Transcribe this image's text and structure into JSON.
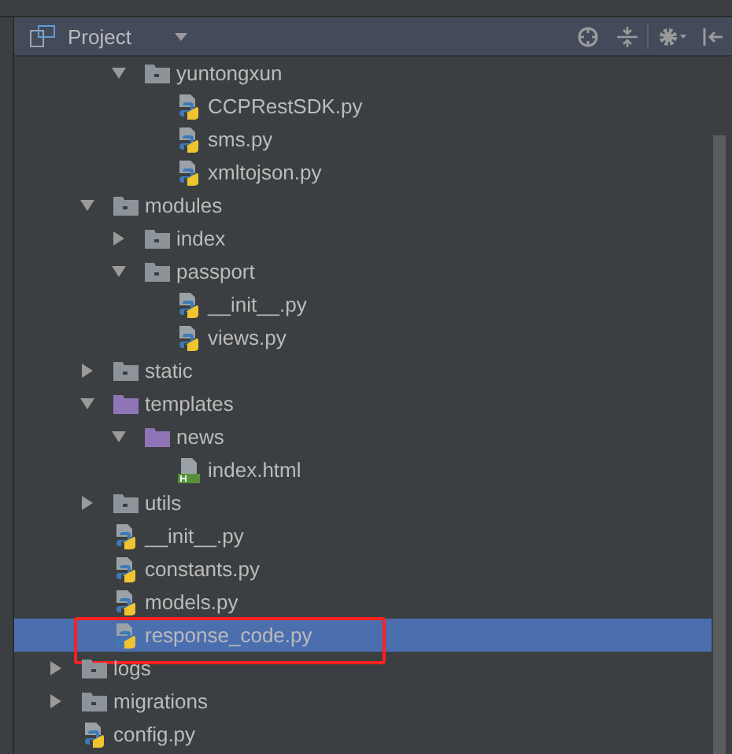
{
  "panel": {
    "title": "Project"
  },
  "tree": [
    {
      "children": [
        {
          "children": [
            {
              "label": "yuntongxun",
              "kind": "folder",
              "expanded": true,
              "selected": false,
              "children": [
                {
                  "label": "CCPRestSDK.py",
                  "kind": "python",
                  "selected": false
                },
                {
                  "label": "sms.py",
                  "kind": "python",
                  "selected": false
                },
                {
                  "label": "xmltojson.py",
                  "kind": "python",
                  "selected": false
                }
              ]
            }
          ]
        },
        {
          "label": "modules",
          "kind": "folder",
          "expanded": true,
          "selected": false,
          "children": [
            {
              "label": "index",
              "kind": "folder",
              "expanded": false,
              "selected": false
            },
            {
              "label": "passport",
              "kind": "folder",
              "expanded": true,
              "selected": false,
              "children": [
                {
                  "label": "__init__.py",
                  "kind": "python",
                  "selected": false
                },
                {
                  "label": "views.py",
                  "kind": "python",
                  "selected": false
                }
              ]
            }
          ]
        },
        {
          "label": "static",
          "kind": "folder",
          "expanded": false,
          "selected": false
        },
        {
          "label": "templates",
          "kind": "template_folder",
          "expanded": true,
          "selected": false,
          "children": [
            {
              "label": "news",
              "kind": "template_folder",
              "expanded": true,
              "selected": false,
              "children": [
                {
                  "label": "index.html",
                  "kind": "html",
                  "selected": false
                }
              ]
            }
          ]
        },
        {
          "label": "utils",
          "kind": "folder",
          "expanded": false,
          "selected": false
        },
        {
          "label": "__init__.py",
          "kind": "python",
          "selected": false
        },
        {
          "label": "constants.py",
          "kind": "python",
          "selected": false
        },
        {
          "label": "models.py",
          "kind": "python",
          "selected": false
        },
        {
          "label": "response_code.py",
          "kind": "python",
          "selected": true,
          "highlighted": true
        }
      ]
    },
    {
      "label": "logs",
      "kind": "folder",
      "expanded": false,
      "selected": false
    },
    {
      "label": "migrations",
      "kind": "folder",
      "expanded": false,
      "selected": false
    },
    {
      "label": "config.py",
      "kind": "python",
      "selected": false
    }
  ]
}
